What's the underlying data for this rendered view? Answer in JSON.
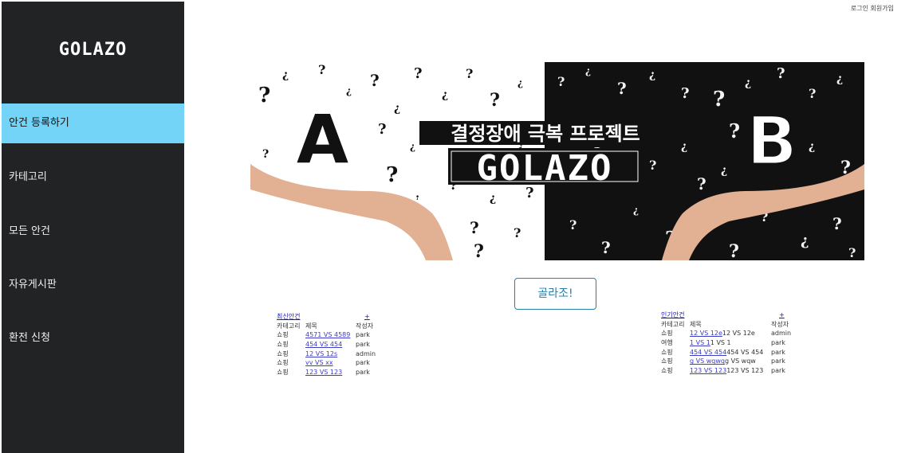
{
  "app": {
    "logo": "GOLAZO"
  },
  "top_links": {
    "login": "로그인",
    "separator": " ",
    "signup": "회원가입"
  },
  "sidebar": {
    "items": [
      {
        "label": "안건 등록하기",
        "active": true
      },
      {
        "label": "카테고리",
        "active": false
      },
      {
        "label": "모든 안건",
        "active": false
      },
      {
        "label": "자유게시판",
        "active": false
      },
      {
        "label": "환전 신청",
        "active": false
      }
    ]
  },
  "banner": {
    "left_letter": "A",
    "right_letter": "B",
    "headline": "결정장애 극복 프로젝트",
    "brand": "GOLAZO"
  },
  "main": {
    "cta_label": "골라조!"
  },
  "latest": {
    "title": "최신안건",
    "plus": "+",
    "headers": {
      "category": "카테고리",
      "subject": "제목",
      "author": "작성자"
    },
    "rows": [
      {
        "category": "쇼핑",
        "link": "4571 VS 4589",
        "extra": "",
        "author": "park"
      },
      {
        "category": "쇼핑",
        "link": "454 VS 454",
        "extra": "",
        "author": "park"
      },
      {
        "category": "쇼핑",
        "link": "12 VS 12s",
        "extra": "",
        "author": "admin"
      },
      {
        "category": "쇼핑",
        "link": "vv VS xx",
        "extra": "",
        "author": "park"
      },
      {
        "category": "쇼핑",
        "link": "123 VS 123",
        "extra": "",
        "author": "park"
      }
    ]
  },
  "popular": {
    "title": "인기안건",
    "plus": "+",
    "headers": {
      "category": "카테고리",
      "subject": "제목",
      "author": "작성자"
    },
    "rows": [
      {
        "category": "쇼핑",
        "link": "12 VS 12e",
        "extra": "12 VS 12e",
        "author": "admin"
      },
      {
        "category": "여행",
        "link": "1 VS 1",
        "extra": "1 VS 1",
        "author": "park"
      },
      {
        "category": "쇼핑",
        "link": "454 VS 454",
        "extra": "454 VS 454",
        "author": "park"
      },
      {
        "category": "쇼핑",
        "link": "g VS wqwq",
        "extra": "g VS wqw",
        "author": "park"
      },
      {
        "category": "쇼핑",
        "link": "123 VS 123",
        "extra": "123 VS 123",
        "author": "park"
      }
    ]
  }
}
